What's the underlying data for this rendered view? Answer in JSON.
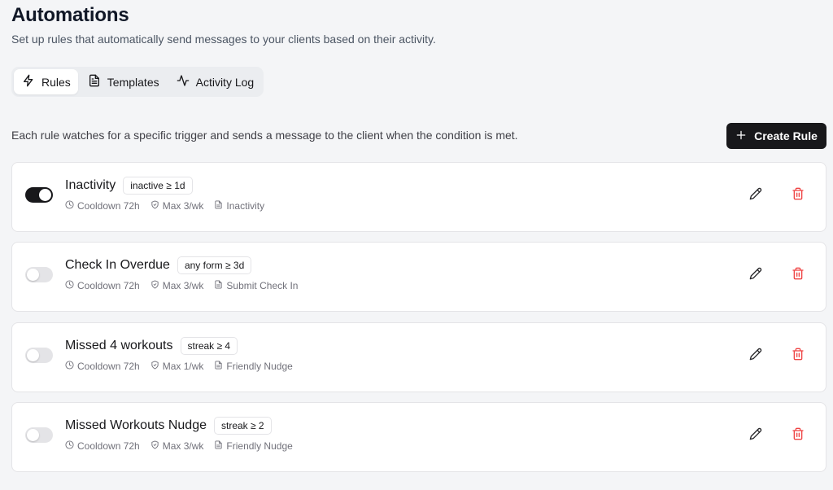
{
  "header": {
    "title": "Automations",
    "subtitle": "Set up rules that automatically send messages to your clients based on their activity."
  },
  "tabs": [
    {
      "label": "Rules",
      "icon": "zap-icon",
      "active": true
    },
    {
      "label": "Templates",
      "icon": "file-text-icon",
      "active": false
    },
    {
      "label": "Activity Log",
      "icon": "activity-icon",
      "active": false
    }
  ],
  "description": "Each rule watches for a specific trigger and sends a message to the client when the condition is met.",
  "create_button": {
    "label": "Create Rule",
    "icon": "plus-icon"
  },
  "colors": {
    "accent": "#18181b",
    "danger": "#ef4444",
    "background": "#f4f5f7"
  },
  "rules": [
    {
      "name": "Inactivity",
      "badge": "inactive ≥ 1d",
      "enabled": true,
      "cooldown": "Cooldown 72h",
      "max": "Max 3/wk",
      "template": "Inactivity"
    },
    {
      "name": "Check In Overdue",
      "badge": "any form ≥ 3d",
      "enabled": false,
      "cooldown": "Cooldown 72h",
      "max": "Max 3/wk",
      "template": "Submit Check In"
    },
    {
      "name": "Missed 4 workouts",
      "badge": "streak ≥ 4",
      "enabled": false,
      "cooldown": "Cooldown 72h",
      "max": "Max 1/wk",
      "template": "Friendly Nudge"
    },
    {
      "name": "Missed Workouts Nudge",
      "badge": "streak ≥ 2",
      "enabled": false,
      "cooldown": "Cooldown 72h",
      "max": "Max 3/wk",
      "template": "Friendly Nudge"
    }
  ]
}
